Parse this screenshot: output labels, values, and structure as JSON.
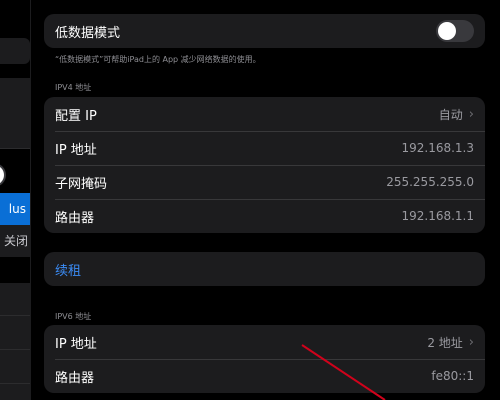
{
  "sidebar": {
    "selected_item_text": "lus",
    "close_item_text": "关闭"
  },
  "low_data": {
    "label": "低数据模式",
    "toggle_on": false,
    "note": "“低数据模式”可帮助iPad上的 App 减少网络数据的使用。"
  },
  "ipv4": {
    "header": "IPV4 地址",
    "rows": [
      {
        "label": "配置 IP",
        "value": "自动"
      },
      {
        "label": "IP 地址",
        "value": "192.168.1.3"
      },
      {
        "label": "子网掩码",
        "value": "255.255.255.0"
      },
      {
        "label": "路由器",
        "value": "192.168.1.1"
      }
    ]
  },
  "renew": {
    "label": "续租"
  },
  "ipv6": {
    "header": "IPV6 地址",
    "rows": [
      {
        "label": "IP 地址",
        "value": "2 地址"
      },
      {
        "label": "路由器",
        "value": "fe80::1"
      }
    ]
  },
  "colors": {
    "accent": "#0a6fd6",
    "link": "#3b8cf6",
    "annotation_arrow": "#d0021b"
  },
  "icons": {
    "chevron": "chevron-right-icon",
    "arrow": "red-arrow-annotation"
  }
}
